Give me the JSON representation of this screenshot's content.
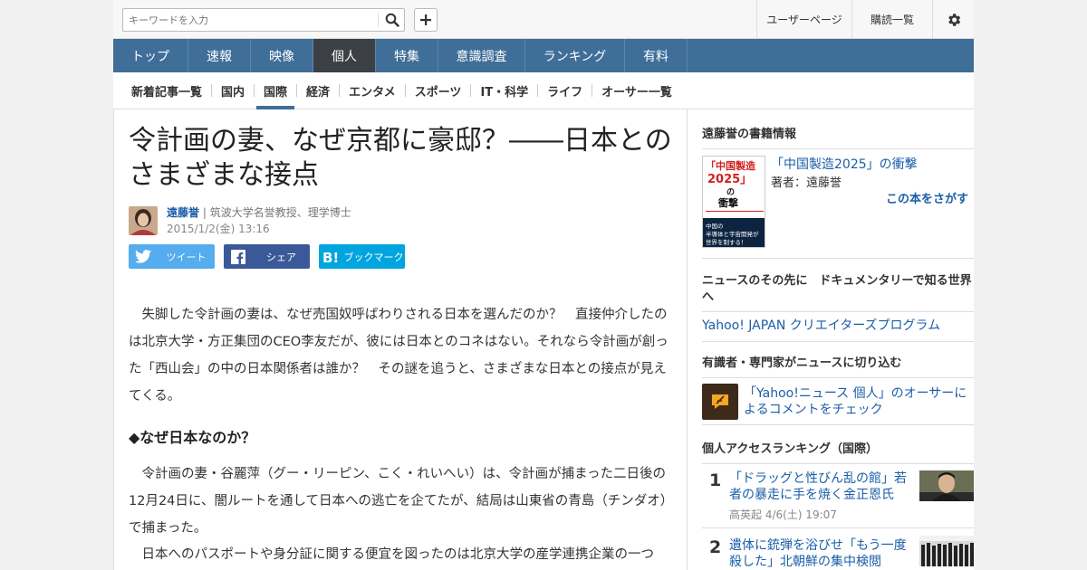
{
  "header": {
    "search_placeholder": "キーワードを入力",
    "user_page": "ユーザーページ",
    "subscriptions": "購読一覧"
  },
  "nav": {
    "items": [
      {
        "label": "トップ",
        "active": false
      },
      {
        "label": "速報",
        "active": false
      },
      {
        "label": "映像",
        "active": false
      },
      {
        "label": "個人",
        "active": true
      },
      {
        "label": "特集",
        "active": false
      },
      {
        "label": "意識調査",
        "active": false
      },
      {
        "label": "ランキング",
        "active": false
      },
      {
        "label": "有料",
        "active": false
      }
    ]
  },
  "subnav": {
    "items": [
      {
        "label": "新着記事一覧",
        "active": false
      },
      {
        "label": "国内",
        "active": false
      },
      {
        "label": "国際",
        "active": true
      },
      {
        "label": "経済",
        "active": false
      },
      {
        "label": "エンタメ",
        "active": false
      },
      {
        "label": "スポーツ",
        "active": false
      },
      {
        "label": "IT・科学",
        "active": false
      },
      {
        "label": "ライフ",
        "active": false
      },
      {
        "label": "オーサー一覧",
        "active": false
      }
    ]
  },
  "article": {
    "title": "令計画の妻、なぜ京都に豪邸？――日本とのさまざまな接点",
    "author_name": "遠藤誉",
    "author_title": "| 筑波大学名誉教授、理学博士",
    "date": "2015/1/2(金) 13:16",
    "share": {
      "tweet": "ツイート",
      "facebook": "シェア",
      "hatena": "ブックマーク"
    },
    "paragraph1": "　失脚した令計画の妻は、なぜ売国奴呼ばわりされる日本を選んだのか？　直接仲介したのは北京大学・方正集団のCEO李友だが、彼には日本とのコネはない。それなら令計画が創った「西山会」の中の日本関係者は誰か？　その謎を追うと、さまざまな日本との接点が見えてくる。",
    "section_heading": "◆なぜ日本なのか？",
    "paragraph2": "　令計画の妻・谷麗萍（グー・リーピン、こく・れいへい）は、令計画が捕まった二日後の12月24日に、闇ルートを通して日本への逃亡を企てたが、結局は山東省の青島（チンダオ）で捕まった。",
    "paragraph3": "　日本へのパスポートや身分証に関する便宜を図ったのは北京大学の産学連携企業の一つ"
  },
  "sidebar": {
    "book": {
      "heading": "遠藤誉の書籍情報",
      "title": "「中国製造2025」の衝撃",
      "author": "著者：遠藤誉",
      "find": "この本をさがす",
      "cover_line1": "「中国製造",
      "cover_line2": "2025」",
      "cover_line3": "の",
      "cover_line4": "衝撃",
      "cover_bottom": "中国の半導体と宇宙開発が世界を制する！"
    },
    "documentary": {
      "heading": "ニュースのその先に　ドキュメンタリーで知る世界へ",
      "link": "Yahoo! JAPAN クリエイターズプログラム"
    },
    "experts": {
      "heading": "有識者・専門家がニュースに切り込む",
      "link": "「Yahoo!ニュース 個人」のオーサーによるコメントをチェック"
    },
    "ranking": {
      "heading": "個人アクセスランキング（国際）",
      "items": [
        {
          "rank": "1",
          "title": "「ドラッグと性びん乱の館」若者の暴走に手を焼く金正恩氏",
          "meta": "高英起  4/6(土) 19:07"
        },
        {
          "rank": "2",
          "title": "遺体に銃弾を浴びせ「もう一度殺した」北朝鮮の集中検閲",
          "meta": ""
        }
      ]
    }
  },
  "colors": {
    "nav_bg": "#3f6e98",
    "nav_active": "#3c3f44",
    "link": "#1a5ea8",
    "twitter": "#55acee",
    "facebook": "#3b5998",
    "hatena": "#00a4de"
  },
  "icons": [
    "search-icon",
    "plus-icon",
    "gear-icon",
    "twitter-icon",
    "facebook-icon",
    "hatena-icon",
    "feather-icon"
  ]
}
